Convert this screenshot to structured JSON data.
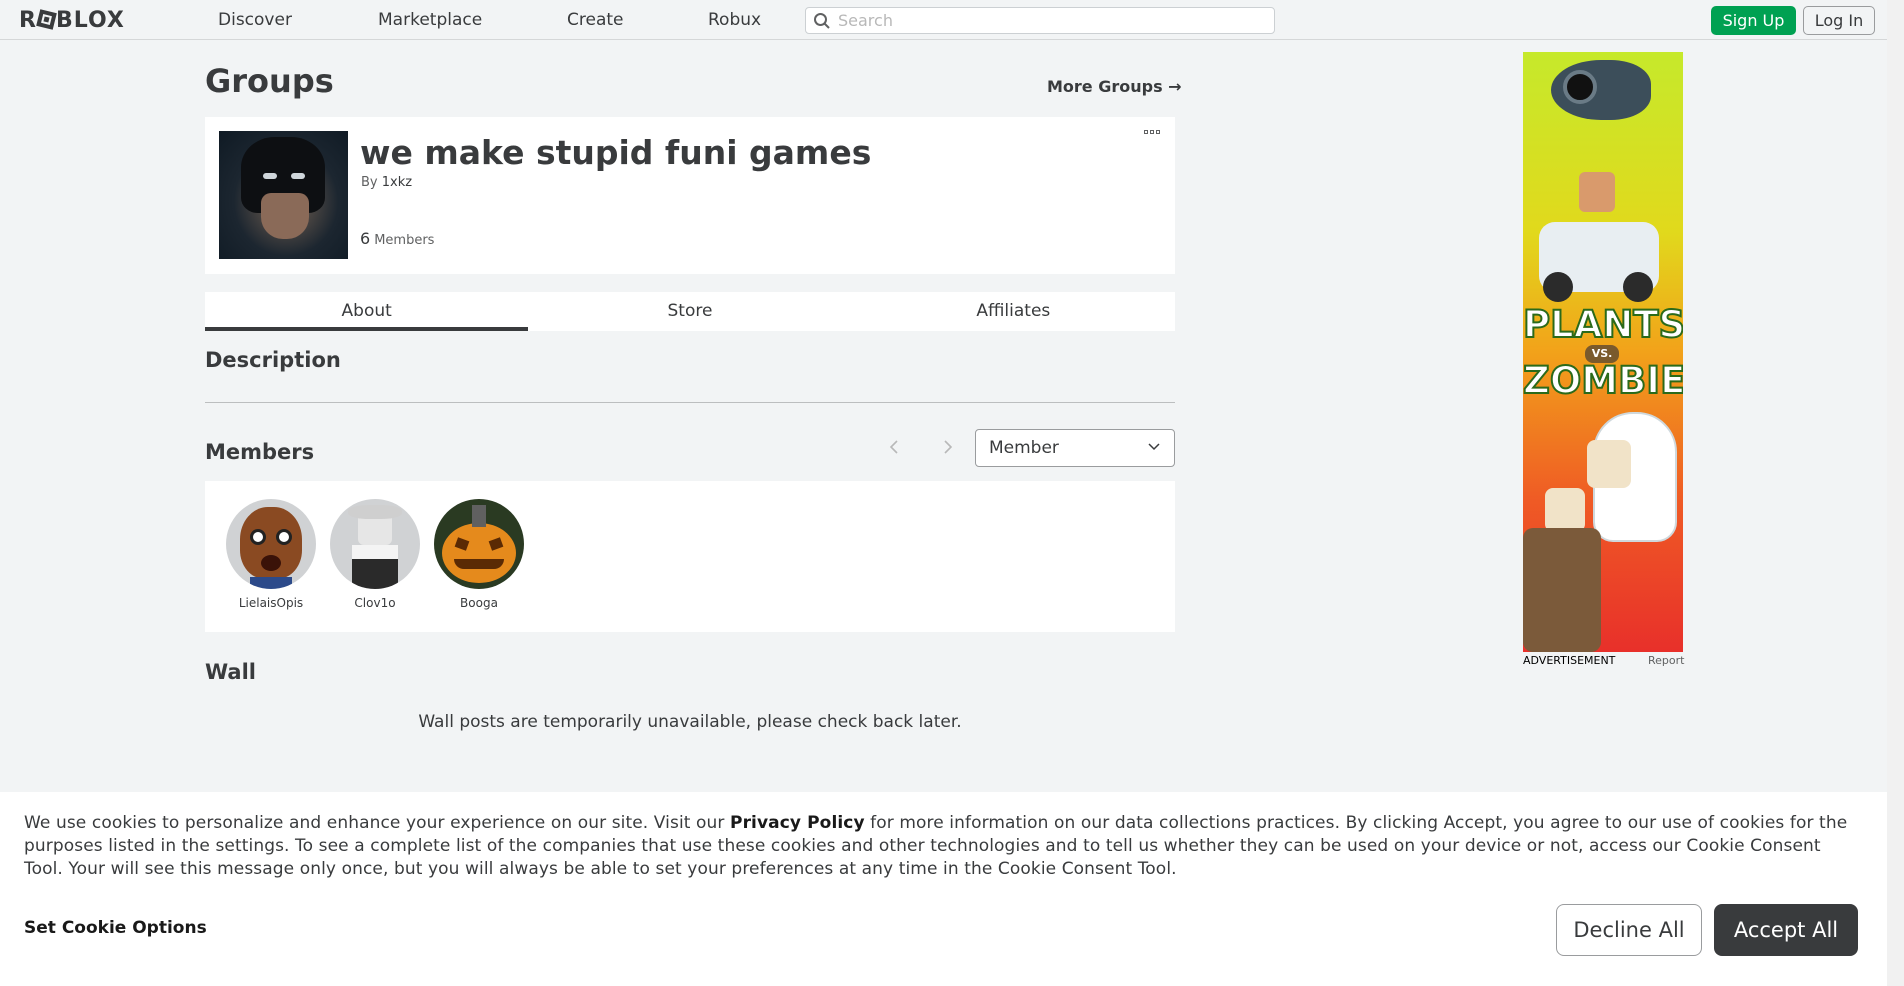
{
  "nav": {
    "logo_text": "ROBLOX",
    "links": [
      "Discover",
      "Marketplace",
      "Create",
      "Robux"
    ],
    "search_placeholder": "Search",
    "signup_label": "Sign Up",
    "login_label": "Log In"
  },
  "page": {
    "title": "Groups",
    "more_groups_label": "More Groups →"
  },
  "group": {
    "name": "we make stupid funi games",
    "by_prefix": "By",
    "owner": "1xkz",
    "member_count": "6",
    "member_label": "Members"
  },
  "tabs": [
    "About",
    "Store",
    "Affiliates"
  ],
  "about": {
    "description_heading": "Description",
    "members_heading": "Members",
    "role_selected": "Member",
    "members": [
      {
        "name": "LielaisOpis",
        "avatar": "scared-face-avatar"
      },
      {
        "name": "Clov1o",
        "avatar": "white-outfit-avatar"
      },
      {
        "name": "Booga",
        "avatar": "pumpkin-avatar"
      }
    ],
    "wall_heading": "Wall",
    "wall_message": "Wall posts are temporarily unavailable, please check back later."
  },
  "ad": {
    "line1": "PLANTS",
    "vs": "VS.",
    "line2": "ZOMBIES",
    "label": "ADVERTISEMENT",
    "report": "Report"
  },
  "cookie": {
    "text_before": "We use cookies to personalize and enhance your experience on our site. Visit our ",
    "privacy_link": "Privacy Policy",
    "text_after": " for more information on our data collections practices. By clicking Accept, you agree to our use of cookies for the purposes listed in the settings. To see a complete list of the companies that use these cookies and other technologies and to tell us whether they can be used on your device or not, access our Cookie Consent Tool. Your will see this message only once, but you will always be able to set your preferences at any time in the Cookie Consent Tool.",
    "set_options_label": "Set Cookie Options",
    "decline_label": "Decline All",
    "accept_label": "Accept All"
  },
  "colors": {
    "signup_green": "#00a152",
    "page_bg": "#f2f4f5",
    "accent_dark": "#393b3d"
  }
}
